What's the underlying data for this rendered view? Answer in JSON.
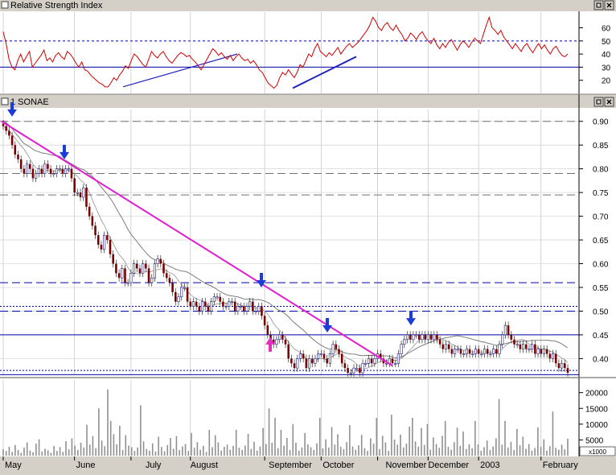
{
  "panels": {
    "rsi_title": "Relative Strength Index",
    "price_title": "1 SONAE",
    "volume_multiplier": "x1000"
  },
  "colors": {
    "background": "#ffffff",
    "title_bar": "#d4d0c8",
    "rsi_line": "#d40000",
    "trendline_blue": "#2020c0",
    "trendline_magenta": "#e020d0",
    "candle_down": "#7a0000",
    "candle_up_outline": "#1a1a80",
    "volume_bar": "#909090",
    "moving_average": "#707070",
    "reference_line": "#0000aa",
    "arrow_down": "#1c3cd8",
    "arrow_up": "#e030c0"
  },
  "chart_data": [
    {
      "type": "line",
      "panel": "rsi",
      "title": "Relative Strength Index",
      "ylim": [
        10,
        72
      ],
      "yticks": [
        20,
        30,
        40,
        50,
        60
      ],
      "reference_levels": [
        30,
        50
      ],
      "series": [
        {
          "values": [
            57,
            48,
            36,
            30,
            28,
            35,
            40,
            34,
            38,
            42,
            30,
            33,
            36,
            39,
            43,
            35,
            37,
            34,
            39,
            41,
            38,
            36,
            42,
            40,
            37,
            33,
            30,
            34,
            28,
            27,
            24,
            22,
            20,
            18,
            17,
            15,
            15,
            18,
            22,
            20,
            24,
            27,
            31,
            29,
            35,
            40,
            38,
            35,
            32,
            30,
            36,
            42,
            39,
            37,
            40,
            42,
            38,
            35,
            33,
            36,
            39,
            41,
            40,
            38,
            39,
            36,
            34,
            31,
            28,
            32,
            36,
            40,
            44,
            42,
            39,
            41,
            38,
            36,
            39,
            35,
            38,
            40,
            37,
            35,
            36,
            33,
            35,
            32,
            28,
            26,
            22,
            18,
            16,
            14,
            16,
            22,
            26,
            24,
            28,
            25,
            22,
            26,
            32,
            30,
            35,
            40,
            38,
            44,
            48,
            42,
            40,
            38,
            41,
            39,
            42,
            45,
            40,
            43,
            46,
            48,
            45,
            47,
            49,
            52,
            55,
            58,
            62,
            68,
            65,
            60,
            58,
            62,
            64,
            60,
            58,
            62,
            58,
            55,
            50,
            52,
            56,
            54,
            51,
            55,
            57,
            53,
            50,
            48,
            52,
            47,
            44,
            48,
            45,
            49,
            51,
            47,
            43,
            47,
            50,
            48,
            45,
            49,
            52,
            50,
            48,
            55,
            62,
            68,
            60,
            58,
            55,
            58,
            53,
            50,
            47,
            44,
            48,
            45,
            42,
            46,
            48,
            44,
            41,
            45,
            48,
            44,
            47,
            43,
            40,
            44,
            46,
            42,
            39,
            38,
            40
          ]
        }
      ],
      "trendlines": [
        {
          "from": [
            "July",
            15
          ],
          "to": [
            "August",
            40
          ],
          "color": "trendline_blue"
        },
        {
          "from": [
            "September",
            14
          ],
          "to": [
            "October",
            38
          ],
          "color": "trendline_blue"
        }
      ]
    },
    {
      "type": "candlestick",
      "panel": "price",
      "title": "1 SONAE",
      "ylim": [
        0.365,
        0.925
      ],
      "yticks": [
        0.9,
        0.85,
        0.8,
        0.75,
        0.7,
        0.65,
        0.6,
        0.55,
        0.5,
        0.45,
        0.4
      ],
      "x_month_labels": [
        "May",
        "June",
        "July",
        "August",
        "September",
        "October",
        "November",
        "December",
        "2003",
        "February"
      ],
      "closes": [
        0.89,
        0.88,
        0.87,
        0.85,
        0.83,
        0.82,
        0.8,
        0.79,
        0.81,
        0.8,
        0.78,
        0.79,
        0.8,
        0.79,
        0.81,
        0.8,
        0.79,
        0.79,
        0.8,
        0.8,
        0.79,
        0.8,
        0.8,
        0.78,
        0.75,
        0.75,
        0.74,
        0.76,
        0.72,
        0.7,
        0.68,
        0.66,
        0.64,
        0.63,
        0.66,
        0.65,
        0.62,
        0.6,
        0.58,
        0.57,
        0.59,
        0.56,
        0.56,
        0.58,
        0.6,
        0.59,
        0.58,
        0.6,
        0.59,
        0.56,
        0.57,
        0.6,
        0.61,
        0.6,
        0.58,
        0.57,
        0.56,
        0.54,
        0.52,
        0.53,
        0.55,
        0.55,
        0.52,
        0.51,
        0.52,
        0.51,
        0.5,
        0.52,
        0.51,
        0.5,
        0.52,
        0.53,
        0.53,
        0.52,
        0.51,
        0.51,
        0.52,
        0.52,
        0.5,
        0.51,
        0.51,
        0.5,
        0.51,
        0.52,
        0.5,
        0.5,
        0.51,
        0.49,
        0.47,
        0.45,
        0.44,
        0.43,
        0.44,
        0.45,
        0.44,
        0.43,
        0.4,
        0.39,
        0.38,
        0.4,
        0.41,
        0.4,
        0.38,
        0.4,
        0.39,
        0.4,
        0.41,
        0.41,
        0.4,
        0.39,
        0.41,
        0.43,
        0.42,
        0.41,
        0.39,
        0.38,
        0.37,
        0.37,
        0.38,
        0.38,
        0.37,
        0.39,
        0.39,
        0.4,
        0.39,
        0.4,
        0.41,
        0.4,
        0.39,
        0.39,
        0.4,
        0.39,
        0.39,
        0.41,
        0.43,
        0.44,
        0.45,
        0.44,
        0.45,
        0.45,
        0.44,
        0.45,
        0.44,
        0.45,
        0.44,
        0.45,
        0.44,
        0.43,
        0.42,
        0.43,
        0.42,
        0.41,
        0.42,
        0.42,
        0.41,
        0.41,
        0.42,
        0.41,
        0.41,
        0.42,
        0.41,
        0.41,
        0.42,
        0.41,
        0.41,
        0.42,
        0.41,
        0.43,
        0.45,
        0.47,
        0.45,
        0.44,
        0.43,
        0.43,
        0.42,
        0.43,
        0.42,
        0.42,
        0.43,
        0.41,
        0.42,
        0.41,
        0.42,
        0.41,
        0.4,
        0.41,
        0.39,
        0.38,
        0.39,
        0.38,
        0.37
      ],
      "horizontal_lines": [
        {
          "value": 0.9,
          "style": "dashed",
          "color": "#707070"
        },
        {
          "value": 0.79,
          "style": "dashed",
          "color": "#707070"
        },
        {
          "value": 0.745,
          "style": "dashed",
          "color": "#707070"
        },
        {
          "value": 0.56,
          "style": "dashed",
          "color": "reference_line"
        },
        {
          "value": 0.5,
          "style": "dashed",
          "color": "reference_line"
        },
        {
          "value": 0.51,
          "style": "dotted",
          "color": "reference_line"
        },
        {
          "value": 0.45,
          "style": "solid",
          "color": "reference_line"
        },
        {
          "value": 0.375,
          "style": "dotted",
          "color": "reference_line"
        },
        {
          "value": 0.366,
          "style": "solid",
          "color": "reference_line"
        }
      ],
      "trendlines": [
        {
          "from": [
            "May",
            0.9
          ],
          "to": [
            "November",
            0.385
          ],
          "color": "trendline_magenta"
        }
      ],
      "arrows": [
        {
          "direction": "down",
          "at": [
            "May",
            0.91
          ]
        },
        {
          "direction": "down",
          "at": [
            "June",
            0.82
          ]
        },
        {
          "direction": "down",
          "at": [
            "September",
            0.55
          ]
        },
        {
          "direction": "down",
          "at": [
            "October",
            0.455
          ]
        },
        {
          "direction": "up",
          "at": [
            "September",
            0.445
          ]
        },
        {
          "direction": "down",
          "at": [
            "December",
            0.47
          ]
        }
      ]
    },
    {
      "type": "bar",
      "panel": "volume",
      "ylim": [
        0,
        24000
      ],
      "yticks": [
        5000,
        10000,
        15000,
        20000
      ],
      "values": [
        2100,
        1500,
        2800,
        1200,
        3400,
        1800,
        900,
        2600,
        4200,
        1600,
        1100,
        3800,
        5200,
        1300,
        2200,
        1700,
        900,
        3100,
        1500,
        2700,
        1200,
        4600,
        2000,
        5500,
        3200,
        1800,
        4100,
        2600,
        9800,
        3500,
        6200,
        2400,
        15000,
        4800,
        3000,
        21000,
        11000,
        6800,
        3600,
        9500,
        1800,
        6500,
        3200,
        2700,
        1500,
        2600,
        16000,
        4500,
        2100,
        1600,
        3900,
        1300,
        6000,
        2800,
        1400,
        3400,
        5600,
        2200,
        6200,
        1800,
        2900,
        3700,
        1500,
        7200,
        2500,
        4300,
        1900,
        3100,
        1200,
        8200,
        2700,
        6500,
        4200,
        1600,
        2800,
        3500,
        1900,
        3100,
        8200,
        2500,
        1800,
        3200,
        6900,
        2100,
        4400,
        1600,
        2900,
        8800,
        3700,
        15000,
        4100,
        12000,
        2400,
        8200,
        3200,
        5600,
        1800,
        10000,
        4100,
        1600,
        2600,
        7200,
        3600,
        2700,
        1800,
        3900,
        12000,
        2300,
        5200,
        2600,
        9100,
        3500,
        6800,
        2800,
        2100,
        4300,
        9700,
        2900,
        1900,
        3300,
        6600,
        2400,
        1500,
        5500,
        3800,
        12000,
        2100,
        6300,
        4200,
        1500,
        13000,
        5100,
        3500,
        6700,
        2600,
        3800,
        9200,
        12000,
        4500,
        2900,
        8800,
        3400,
        10000,
        1900,
        5800,
        3700,
        2500,
        6300,
        11000,
        2800,
        1900,
        4300,
        8900,
        3100,
        7700,
        2100,
        3600,
        2400,
        11000,
        3600,
        1600,
        2700,
        4800,
        1800,
        2900,
        5500,
        18000,
        3500,
        11000,
        2600,
        4400,
        1800,
        8500,
        3300,
        6000,
        2200,
        3700,
        1600,
        2400,
        9000,
        2800,
        5200,
        1600,
        3000,
        14000,
        2500,
        1900,
        3500,
        2000,
        5400
      ]
    }
  ]
}
